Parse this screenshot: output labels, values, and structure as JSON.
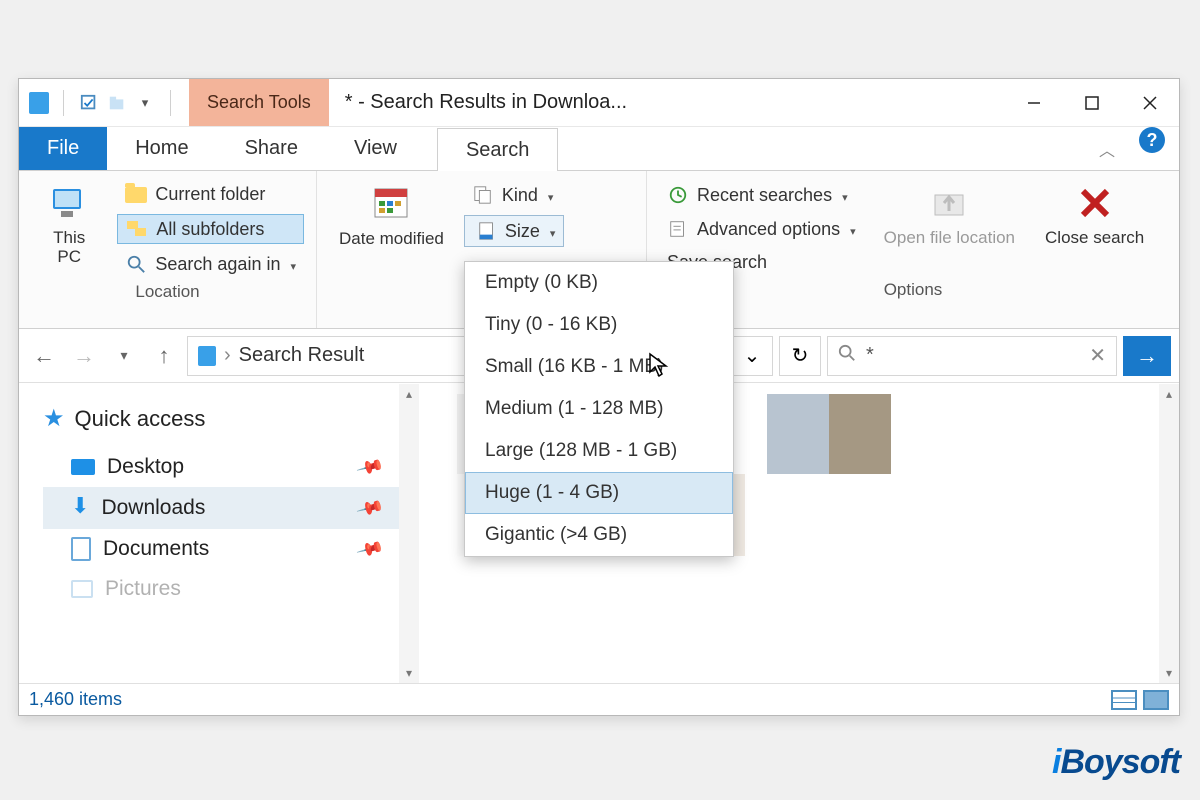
{
  "titlebar": {
    "context_tab": "Search Tools",
    "title": "* - Search Results in Downloa..."
  },
  "tabs": {
    "file": "File",
    "home": "Home",
    "share": "Share",
    "view": "View",
    "search": "Search"
  },
  "ribbon": {
    "location": {
      "current_folder": "Current folder",
      "all_subfolders": "All subfolders",
      "search_again_in": "Search again in",
      "this_pc": "This PC",
      "group_label": "Location"
    },
    "refine": {
      "date_modified": "Date modified",
      "kind": "Kind",
      "size": "Size"
    },
    "options": {
      "recent_searches": "Recent searches",
      "advanced_options": "Advanced options",
      "save_search": "Save search",
      "open_file_location": "Open file location",
      "close_search": "Close search",
      "group_label": "Options"
    }
  },
  "size_menu": {
    "items": [
      "Empty (0 KB)",
      "Tiny (0 - 16 KB)",
      "Small (16 KB - 1 MB)",
      "Medium (1 - 128 MB)",
      "Large (128 MB - 1 GB)",
      "Huge (1 - 4 GB)",
      "Gigantic (>4 GB)"
    ],
    "hover_index": 5
  },
  "address": {
    "text": "Search Result"
  },
  "search": {
    "query": "*"
  },
  "sidebar": {
    "quick_access": "Quick access",
    "items": [
      "Desktop",
      "Downloads",
      "Documents",
      "Pictures"
    ],
    "selected_index": 1
  },
  "status": {
    "items": "1,460 items"
  },
  "watermark": "iBoysoft"
}
